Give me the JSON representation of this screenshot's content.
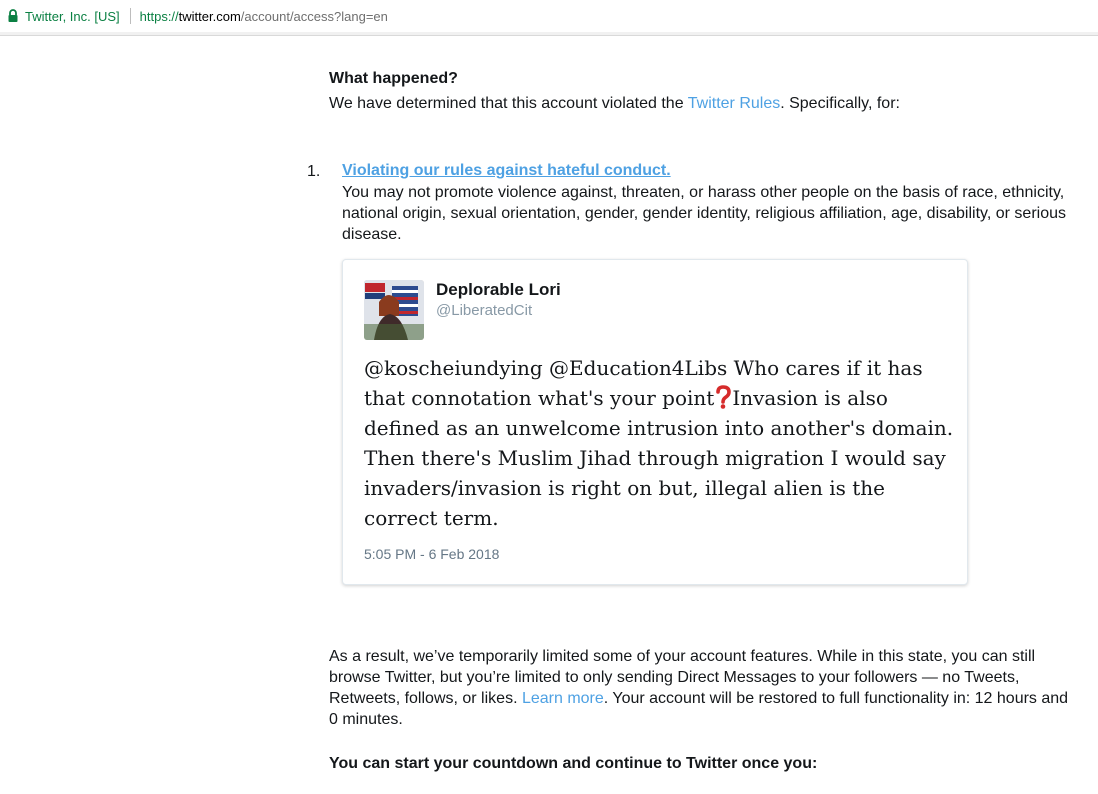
{
  "address_bar": {
    "site_identity": "Twitter, Inc. [US]",
    "url_scheme": "https://",
    "url_host": "twitter.com",
    "url_path": "/account/access?lang=en",
    "lock_icon": "lock-icon"
  },
  "intro": {
    "heading": "What happened?",
    "text_before": "We have determined that this account violated the ",
    "rules_link": "Twitter Rules",
    "text_after": ". Specifically, for:"
  },
  "violation": {
    "number": "1.",
    "title": "Violating our rules against hateful conduct.",
    "description": "You may not promote violence against, threaten, or harass other people on the basis of race, ethnicity, national origin, sexual orientation, gender, gender identity, religious affiliation, age, disability, or serious disease."
  },
  "tweet": {
    "author_name": "Deplorable Lori",
    "author_handle": "@LiberatedCit",
    "text_before_icon": "@koscheiundying @Education4Libs Who cares if it has that connotation what's your point",
    "icon": "red-question-mark-icon",
    "text_after_icon": "Invasion is also defined as an unwelcome intrusion into another's domain. Then there's Muslim Jihad through migration I would say invaders/invasion is right on but, illegal alien is the correct term.",
    "timestamp": "5:05 PM - 6 Feb 2018"
  },
  "result": {
    "text_before": "As a result, we’ve temporarily limited some of your account features. While in this state, you can still browse Twitter, but you’re limited to only sending Direct Messages to your followers — no Tweets, Retweets, follows, or likes. ",
    "learn_more_link": "Learn more",
    "text_after": ". Your account will be restored to full functionality in: 12 hours and 0 minutes."
  },
  "countdown": {
    "heading": "You can start your countdown and continue to Twitter once you:"
  },
  "colors": {
    "link": "#4ea1e3",
    "secure_green": "#0b8043",
    "text": "#14171a",
    "muted": "#657786"
  }
}
